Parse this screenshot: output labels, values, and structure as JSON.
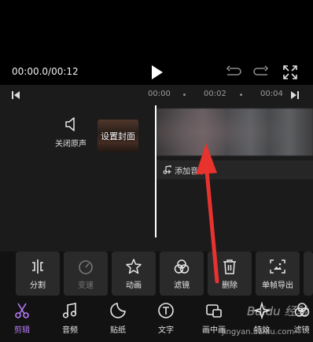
{
  "player": {
    "timecode": "00:00.0/00:12"
  },
  "ruler": {
    "ticks": [
      "00:00",
      "00:02",
      "00:04"
    ]
  },
  "track": {
    "mute_label": "关闭原声",
    "cover_label": "设置封面",
    "add_music_label": "添加音乐"
  },
  "toolbar": {
    "items": [
      {
        "label": "分割",
        "icon": "split-icon"
      },
      {
        "label": "变速",
        "icon": "speed-icon"
      },
      {
        "label": "动画",
        "icon": "animation-icon"
      },
      {
        "label": "滤镜",
        "icon": "filter-icon"
      },
      {
        "label": "删除",
        "icon": "trash-icon"
      },
      {
        "label": "单帧导出",
        "icon": "frame-export-icon"
      }
    ]
  },
  "nav": {
    "items": [
      {
        "label": "剪辑",
        "icon": "scissors-icon"
      },
      {
        "label": "音频",
        "icon": "music-icon"
      },
      {
        "label": "贴纸",
        "icon": "sticker-icon"
      },
      {
        "label": "文字",
        "icon": "text-icon"
      },
      {
        "label": "画中画",
        "icon": "pip-icon"
      },
      {
        "label": "特效",
        "icon": "effects-icon"
      },
      {
        "label": "滤镜",
        "icon": "filter-icon"
      }
    ]
  },
  "watermark": {
    "text": "Baidu 经验",
    "url": "jingyan.baidu.com"
  },
  "colors": {
    "accent": "#b57bf5",
    "annotation_arrow": "#e8322e",
    "background": "#121212"
  }
}
